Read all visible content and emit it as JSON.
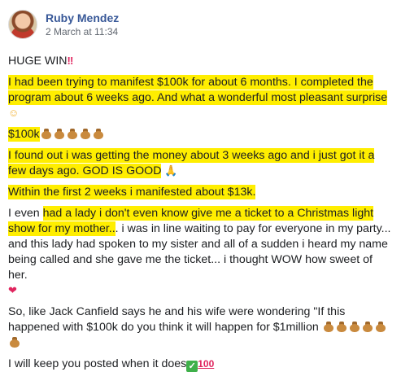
{
  "post": {
    "author": "Ruby Mendez",
    "timestamp": "2 March at 11:34",
    "headline": "HUGE WIN",
    "p1": "I had been trying to manifest $100k for about 6 months. I completed the program about 6 weeks ago. And what a wonderful most pleasant surprise",
    "p2": "$100k",
    "p3": "I found out i was getting the money about 3 weeks ago and i just got it a few days ago. GOD IS GOOD",
    "p4": "Within the first 2 weeks i manifested about $13k.",
    "p5_a": "I even ",
    "p5_hl": "had a lady i don't even know give me a ticket to a Christmas light show for my mother..",
    "p5_b": ". i was in line waiting to pay for everyone in my party... and this lady had spoken to my sister and all of a sudden i heard my name being called and she gave me the ticket... i thought WOW how sweet of her.",
    "p6": "So, like Jack Canfield says he and his wife were wondering \"If this happened with $100k do you think it will happen for $1million",
    "p7": "I will keep you posted when it does"
  },
  "icons": {
    "double-exclamation": "‼",
    "money-bag": "money-bag-icon",
    "pray": "🙏",
    "check": "✓",
    "hundred": "100"
  }
}
